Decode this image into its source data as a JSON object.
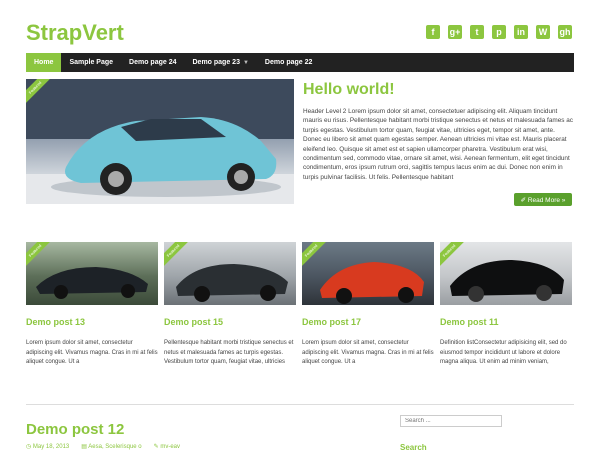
{
  "site": {
    "title": "StrapVert"
  },
  "social": [
    {
      "icon": "facebook-icon",
      "glyph": "f"
    },
    {
      "icon": "google-plus-icon",
      "glyph": "g+"
    },
    {
      "icon": "twitter-icon",
      "glyph": "t"
    },
    {
      "icon": "pinterest-icon",
      "glyph": "p"
    },
    {
      "icon": "linkedin-icon",
      "glyph": "in"
    },
    {
      "icon": "wordpress-icon",
      "glyph": "W"
    },
    {
      "icon": "github-icon",
      "glyph": "gh"
    }
  ],
  "nav": [
    {
      "label": "Home",
      "active": true
    },
    {
      "label": "Sample Page"
    },
    {
      "label": "Demo page 24"
    },
    {
      "label": "Demo page 23",
      "has_dropdown": true
    },
    {
      "label": "Demo page 22"
    }
  ],
  "featured": {
    "ribbon": "Featured",
    "title": "Hello world!",
    "body": "Header Level 2 Lorem ipsum dolor sit amet, consectetuer adipiscing elit. Aliquam tincidunt mauris eu risus. Pellentesque habitant morbi tristique senectus et netus et malesuada fames ac turpis egestas. Vestibulum tortor quam, feugiat vitae, ultricies eget, tempor sit amet, ante. Donec eu libero sit amet quam egestas semper. Aenean ultricies mi vitae est. Mauris placerat eleifend leo. Quisque sit amet est et sapien ullamcorper pharetra. Vestibulum erat wisi, condimentum sed, commodo vitae, ornare sit amet, wisi. Aenean fermentum, elit eget tincidunt condimentum, eros ipsum rutrum orci, sagittis tempus lacus enim ac dui. Donec non enim in turpis pulvinar facilisis. Ut felis. Pellentesque habitant",
    "read_more": "✐ Read More »"
  },
  "cards": [
    {
      "ribbon": "Featured",
      "title": "Demo post 13",
      "excerpt": "Lorem ipsum dolor sit amet, consectetur adipiscing elit. Vivamus magna. Cras in mi at felis aliquet congue. Ut a"
    },
    {
      "ribbon": "Featured",
      "title": "Demo post 15",
      "excerpt": "Pellentesque habitant morbi tristique senectus et netus et malesuada fames ac turpis egestas. Vestibulum tortor quam, feugiat vitae, ultricies"
    },
    {
      "ribbon": "Featured",
      "title": "Demo post 17",
      "excerpt": "Lorem ipsum dolor sit amet, consectetur adipiscing elit. Vivamus magna. Cras in mi at felis aliquet congue. Ut a"
    },
    {
      "ribbon": "Featured",
      "title": "Demo post 11",
      "excerpt": "Definition listConsectetur adipisicing elit, sed do eiusmod tempor incididunt ut labore et dolore magna aliqua. Ut enim ad minim veniam,"
    }
  ],
  "latest": {
    "title": "Demo post 12",
    "date": "◷ May 18, 2013",
    "category": "▤ Aesa, Scelerisque o",
    "author": "✎ mv-eav"
  },
  "sidebar": {
    "search_placeholder": "Search ...",
    "widget_title": "Search"
  },
  "colors": {
    "accent": "#8cc63f",
    "nav_bg": "#222222",
    "button": "#5aa02c"
  }
}
